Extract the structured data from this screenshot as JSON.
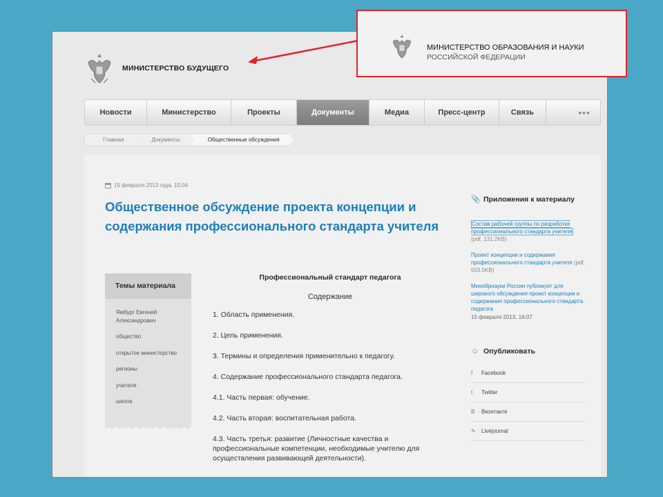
{
  "header": {
    "site_title": "МИНИСТЕРСТВО БУДУЩЕГО",
    "emblem_icon": "eagle-emblem-icon"
  },
  "nav": {
    "items": [
      {
        "label": "Новости",
        "active": false
      },
      {
        "label": "Министерство",
        "active": false
      },
      {
        "label": "Проекты",
        "active": false
      },
      {
        "label": "Документы",
        "active": true
      },
      {
        "label": "Медиа",
        "active": false
      },
      {
        "label": "Пресс-центр",
        "active": false
      },
      {
        "label": "Связь",
        "active": false
      }
    ],
    "more_label": "•••"
  },
  "breadcrumb": [
    "Главная",
    "Документы",
    "Общественные обсуждения"
  ],
  "article": {
    "date": "15 февраля 2013 года, 15:04",
    "title": "Общественное обсуждение проекта концепции и содержания профессионального стандарта учителя",
    "doc_title": "Профессиональный стандарт педагога",
    "doc_subtitle": "Содержание",
    "paragraphs": [
      "1. Область применения.",
      "2. Цель применения.",
      "3. Термины и определения применительно к педагогу.",
      "4. Содержание профессионального стандарта педагога.",
      "4.1. Часть первая: обучение.",
      "4.2. Часть вторая: воспитательная работа.",
      "4.3. Часть третья: развитие (Личностные качества и профессиональные компетенции, необходимые учителю для осуществления развивающей деятельности)."
    ]
  },
  "topics": {
    "heading": "Темы материала",
    "items": [
      "Ямбург Евгений Александрович",
      "общество",
      "открытое министерство",
      "регионы",
      "учителя",
      "школа"
    ]
  },
  "attachments": {
    "heading": "Приложения к материалу",
    "heading_icon": "paperclip-icon",
    "items": [
      {
        "text": "Состав рабочей группы по разработке профессионального стандарта учителя",
        "meta": "(pdf, 131.2KB)"
      },
      {
        "text": "Проект концепции и содержания профессионального стандарта учителя",
        "meta": "(pdf, 503.5KB)"
      },
      {
        "text": "Минобрнауки России публикует для широкого обсуждения проект концепции и содержания профессионального стандарта педагога",
        "meta": ""
      }
    ],
    "news_date": "15 февраля 2013, 16:07"
  },
  "share": {
    "heading": "Опубликовать",
    "heading_icon": "people-icon",
    "items": [
      {
        "label": "Facebook",
        "glyph": "f",
        "icon": "facebook-icon"
      },
      {
        "label": "Twitter",
        "glyph": "t",
        "icon": "twitter-icon"
      },
      {
        "label": "Вконтакте",
        "glyph": "В",
        "icon": "vkontakte-icon"
      },
      {
        "label": "Livejournal",
        "glyph": "✎",
        "icon": "livejournal-icon"
      }
    ]
  },
  "callout": {
    "line1": "МИНИСТЕРСТВО ОБРАЗОВАНИЯ И НАУКИ",
    "line2": "РОССИЙСКОЙ ФЕДЕРАЦИИ",
    "accent_color": "#e2232a"
  },
  "colors": {
    "link": "#1a7fbd",
    "background": "#4aa8c6",
    "nav_active": "#858585"
  }
}
